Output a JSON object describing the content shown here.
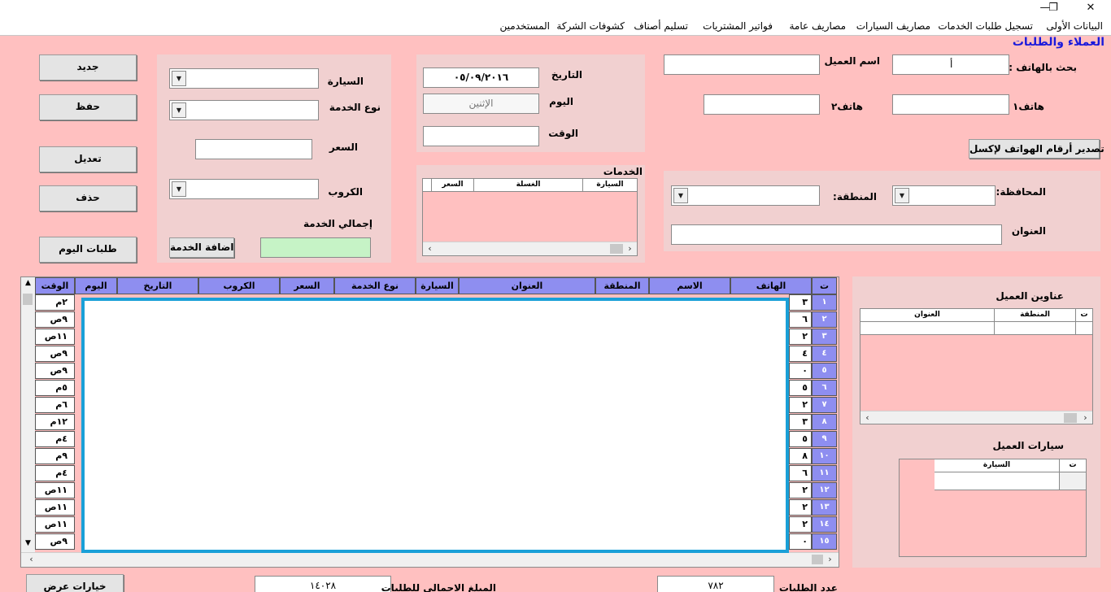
{
  "window": {
    "minimize_glyph": "—",
    "restore_glyph": "❐",
    "close_glyph": "✕"
  },
  "menu": [
    "البيانات الأولى",
    "تسجيل طلبات الخدمات",
    "مصاريف السيارات",
    "مصاريف عامة",
    "فواتير المشتريات",
    "تسليم أصناف",
    "كشوفات الشركة",
    "المستخدمين"
  ],
  "form_title": "العملاء والطلبات",
  "customer": {
    "search_phone_label": "بحث بالهاتف :",
    "search_phone_value": "أ",
    "name_label": "اسم العميل :",
    "name_value": "",
    "phone1_label": "هاتف١",
    "phone1_value": "",
    "phone2_label": "هاتف٢",
    "phone2_value": "",
    "export_button": "تصدير أرقام الهواتف لإكسل"
  },
  "location": {
    "governorate_label": "المحافظة:",
    "region_label": "المنطقة:",
    "address_label": "العنوان",
    "governorate_value": "",
    "region_value": "",
    "address_value": ""
  },
  "datetime": {
    "date_label": "التاريخ",
    "date_value": "٠٥/٠٩/٢٠١٦",
    "day_label": "اليوم",
    "day_value": "الإثنين",
    "time_label": "الوقت",
    "time_value": ""
  },
  "services": {
    "title": "الخدمات",
    "columns": [
      "السيارة",
      "الغسلة",
      "السعر"
    ]
  },
  "service_form": {
    "car_label": "السيارة",
    "service_type_label": "نوع الخدمة",
    "price_label": "السعر",
    "coupon_label": "الكروب",
    "total_label": "إجمالي الخدمة",
    "add_button": "اضافة الخدمة",
    "total_value": ""
  },
  "actions": {
    "new": "جديد",
    "save": "حفظ",
    "edit": "تعديل",
    "delete": "حذف",
    "today_orders": "طلبات اليوم",
    "display_options": "خيارات عرض"
  },
  "orders_grid": {
    "columns": [
      "ت",
      "الهاتف",
      "الاسم",
      "المنطقة",
      "العنوان",
      "السيارة",
      "نوع الخدمة",
      "السعر",
      "الكروب",
      "التاريخ",
      "اليوم",
      "الوقت"
    ],
    "rows": [
      {
        "n": "١",
        "phone_digit": "٣",
        "time": "٢م"
      },
      {
        "n": "٢",
        "phone_digit": "٦",
        "time": "٩ص"
      },
      {
        "n": "٣",
        "phone_digit": "٢",
        "time": "١١ص"
      },
      {
        "n": "٤",
        "phone_digit": "٤",
        "time": "٩ص"
      },
      {
        "n": "٥",
        "phone_digit": "٠",
        "time": "٩ص"
      },
      {
        "n": "٦",
        "phone_digit": "٥",
        "time": "٥م"
      },
      {
        "n": "٧",
        "phone_digit": "٢",
        "time": "٦م"
      },
      {
        "n": "٨",
        "phone_digit": "٣",
        "time": "١٢م"
      },
      {
        "n": "٩",
        "phone_digit": "٥",
        "time": "٤م"
      },
      {
        "n": "١٠",
        "phone_digit": "٨",
        "time": "٩م"
      },
      {
        "n": "١١",
        "phone_digit": "٦",
        "time": "٤م"
      },
      {
        "n": "١٢",
        "phone_digit": "٢",
        "time": "١١ص"
      },
      {
        "n": "١٣",
        "phone_digit": "٢",
        "time": "١١ص"
      },
      {
        "n": "١٤",
        "phone_digit": "٢",
        "time": "١١ص"
      },
      {
        "n": "١٥",
        "phone_digit": "٠",
        "time": "٩ص"
      }
    ]
  },
  "customer_addresses": {
    "title": "عناوين العميل",
    "columns": [
      "ت",
      "المنطقة",
      "العنوان"
    ]
  },
  "customer_cars": {
    "title": "سيارات العميل",
    "columns": [
      "ت",
      "السيارة"
    ]
  },
  "footer": {
    "orders_count_label": "عدد الطلبات",
    "orders_count_value": "٧٨٢",
    "total_amount_label": "المبلغ الاجمالي للطلبات",
    "total_amount_value": "١٤٠٢٨"
  }
}
